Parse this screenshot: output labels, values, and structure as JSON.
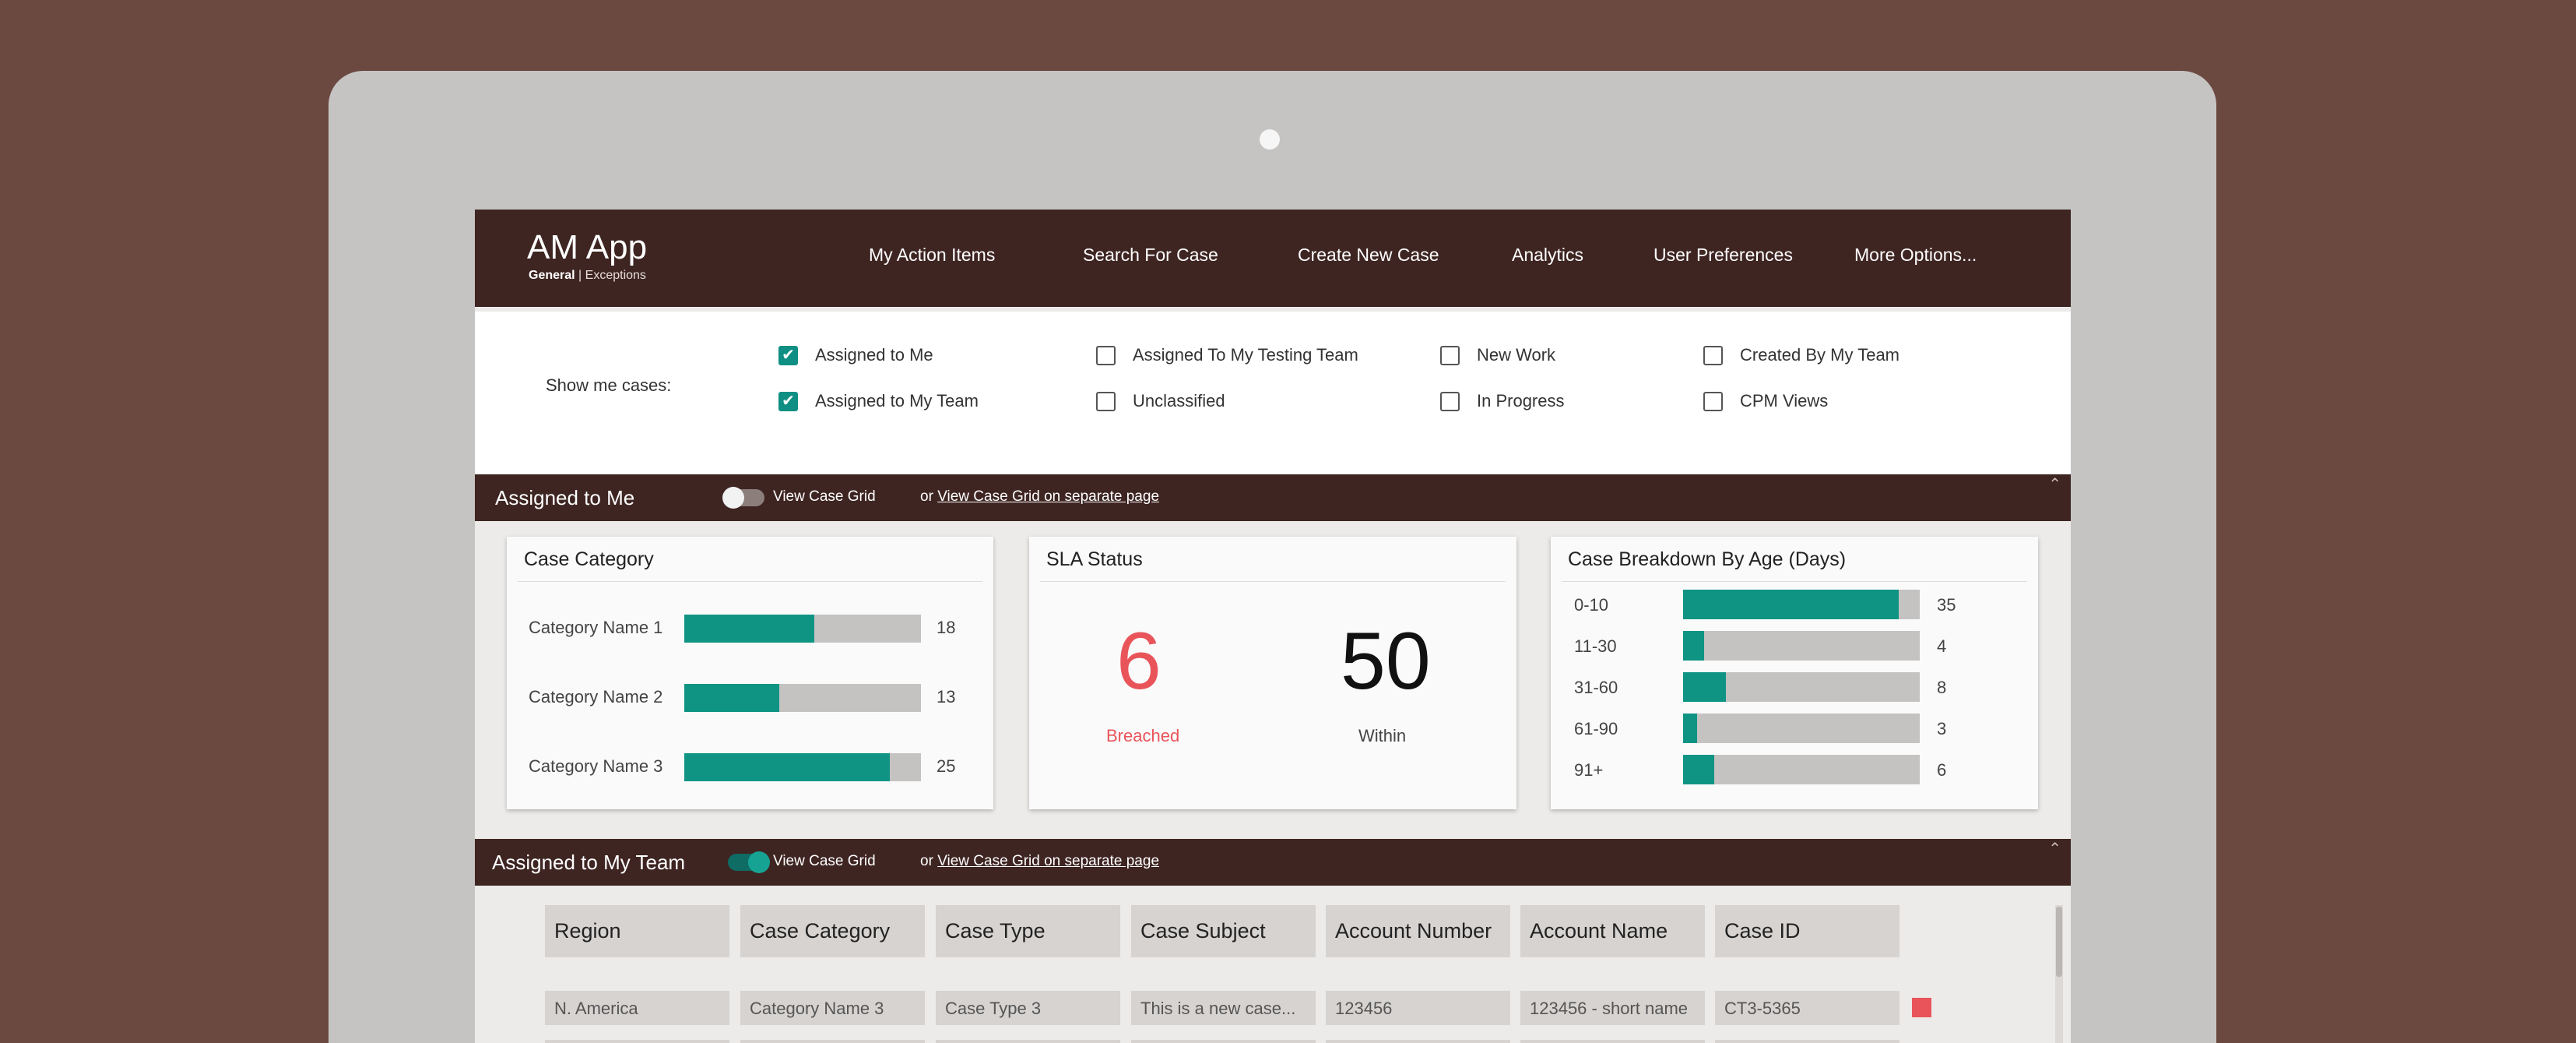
{
  "app": {
    "title": "AM App",
    "sub_bold": "General",
    "sub_rest": "| Exceptions"
  },
  "nav": [
    "My Action Items",
    "Search For Case",
    "Create New Case",
    "Analytics",
    "User Preferences",
    "More Options..."
  ],
  "filters": {
    "label": "Show me cases:",
    "options": [
      {
        "label": "Assigned to Me",
        "checked": true
      },
      {
        "label": "Assigned to My Team",
        "checked": true
      },
      {
        "label": "Assigned To My Testing Team",
        "checked": false
      },
      {
        "label": "Unclassified",
        "checked": false
      },
      {
        "label": "New Work",
        "checked": false
      },
      {
        "label": "In Progress",
        "checked": false
      },
      {
        "label": "Created By My Team",
        "checked": false
      },
      {
        "label": "CPM Views",
        "checked": false
      }
    ]
  },
  "section_me": {
    "title": "Assigned to Me",
    "toggle_label": "View Case Grid",
    "toggle_on": false,
    "or": "or",
    "link": "View Case Grid on separate page"
  },
  "section_team": {
    "title": "Assigned to My Team",
    "toggle_label": "View Case Grid",
    "toggle_on": true,
    "or": "or",
    "link": "View Case Grid on separate page"
  },
  "card_category": {
    "title": "Case Category",
    "items": [
      {
        "label": "Category Name 1",
        "value": "18",
        "fill": 0.55
      },
      {
        "label": "Category Name 2",
        "value": "13",
        "fill": 0.4
      },
      {
        "label": "Category Name 3",
        "value": "25",
        "fill": 0.87
      }
    ]
  },
  "card_sla": {
    "title": "SLA Status",
    "breached_value": "6",
    "breached_label": "Breached",
    "within_value": "50",
    "within_label": "Within",
    "breached_color": "#e9545a"
  },
  "card_age": {
    "title": "Case Breakdown By Age (Days)",
    "items": [
      {
        "label": "0-10",
        "value": "35",
        "fill": 0.91
      },
      {
        "label": "11-30",
        "value": "4",
        "fill": 0.09
      },
      {
        "label": "31-60",
        "value": "8",
        "fill": 0.18
      },
      {
        "label": "61-90",
        "value": "3",
        "fill": 0.06
      },
      {
        "label": "91+",
        "value": "6",
        "fill": 0.13
      }
    ]
  },
  "grid": {
    "columns": [
      "Region",
      "Case Category",
      "Case Type",
      "Case Subject",
      "Account Number",
      "Account Name",
      "Case ID"
    ],
    "rows": [
      [
        "N. America",
        "Category Name 3",
        "Case Type 3",
        "This is a new case...",
        "123456",
        "123456 - short name",
        "CT3-5365"
      ]
    ]
  },
  "colors": {
    "accent": "#0f9484",
    "header": "#3e2522",
    "alert": "#e9545a"
  }
}
